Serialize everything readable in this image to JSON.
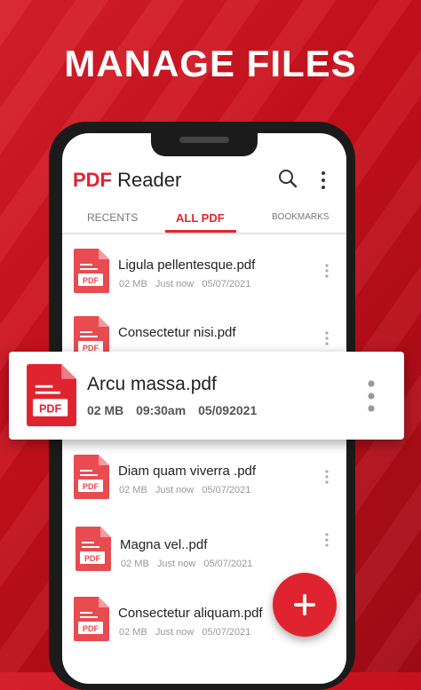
{
  "headline": "MANAGE FILES",
  "app": {
    "title_accent": "PDF",
    "title_rest": "Reader"
  },
  "tabs": [
    {
      "label": "RECENTS",
      "active": false
    },
    {
      "label": "ALL PDF",
      "active": true
    },
    {
      "label": "BOOKMARKS",
      "active": false
    }
  ],
  "icons": {
    "search": "search-icon",
    "menu": "more-vertical-icon",
    "file": "pdf-file-icon",
    "add": "plus-icon"
  },
  "pdf_badge": "PDF",
  "files": [
    {
      "name": "Ligula pellentesque.pdf",
      "size": "02 MB",
      "time": "Just now",
      "date": "05/07/2021"
    },
    {
      "name": "Consectetur nisi.pdf",
      "size": "",
      "time": "",
      "date": ""
    },
    {
      "name": "Diam quam viverra .pdf",
      "size": "02 MB",
      "time": "Just now",
      "date": "05/07/2021"
    },
    {
      "name": "Magna vel..pdf",
      "size": "02 MB",
      "time": "Just now",
      "date": "05/07/2021"
    },
    {
      "name": "Consectetur aliquam.pdf",
      "size": "02 MB",
      "time": "Just now",
      "date": "05/07/2021"
    }
  ],
  "featured_file": {
    "name": "Arcu massa.pdf",
    "size": "02 MB",
    "time": "09:30am",
    "date": "05/092021"
  },
  "colors": {
    "accent": "#e0242f",
    "background": "#c8101c"
  }
}
